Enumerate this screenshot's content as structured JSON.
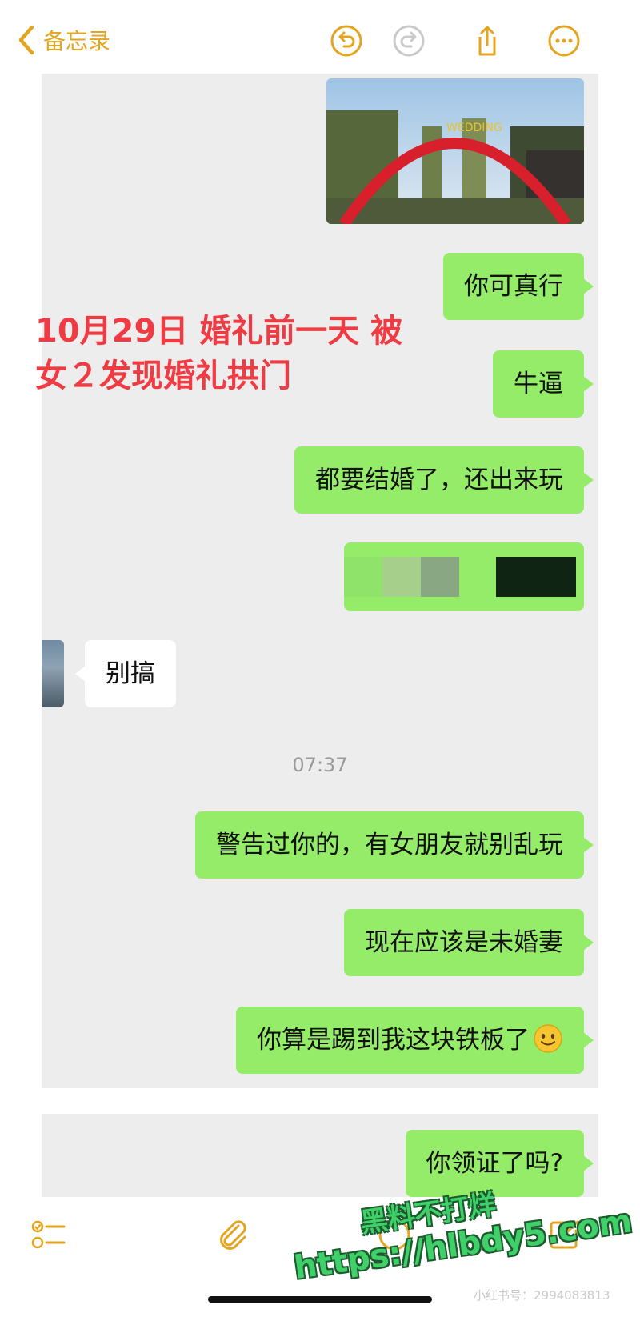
{
  "topbar": {
    "back_label": "备忘录",
    "accent_color": "#e3a51f",
    "icons": [
      "undo-icon",
      "redo-icon",
      "share-icon",
      "more-icon"
    ]
  },
  "caption": {
    "line1": "10月29日 婚礼前一天 被",
    "line2": "女２发现婚礼拱门",
    "color": "#ef3b43"
  },
  "chat": {
    "photo_text": "WEDDING",
    "messages_before": [
      "你可真行",
      "牛逼",
      "都要结婚了，还出来玩"
    ],
    "redacted_message": "redacted",
    "incoming": "别搞",
    "time": "07:37",
    "messages_after": [
      "警告过你的，有女朋友就别乱玩",
      "现在应该是未婚妻",
      "你算是踢到我这块铁板了"
    ],
    "last_message": "你领证了吗?",
    "bubble_color": "#95ec69"
  },
  "bottombar": {
    "icons": [
      "checklist-icon",
      "attachment-icon",
      "markup-icon",
      "compose-icon"
    ]
  },
  "watermark": {
    "line1": "黑料不打烊",
    "line2": "https://hlbdy5.com"
  },
  "source_tag": "小红书号：2994083813"
}
